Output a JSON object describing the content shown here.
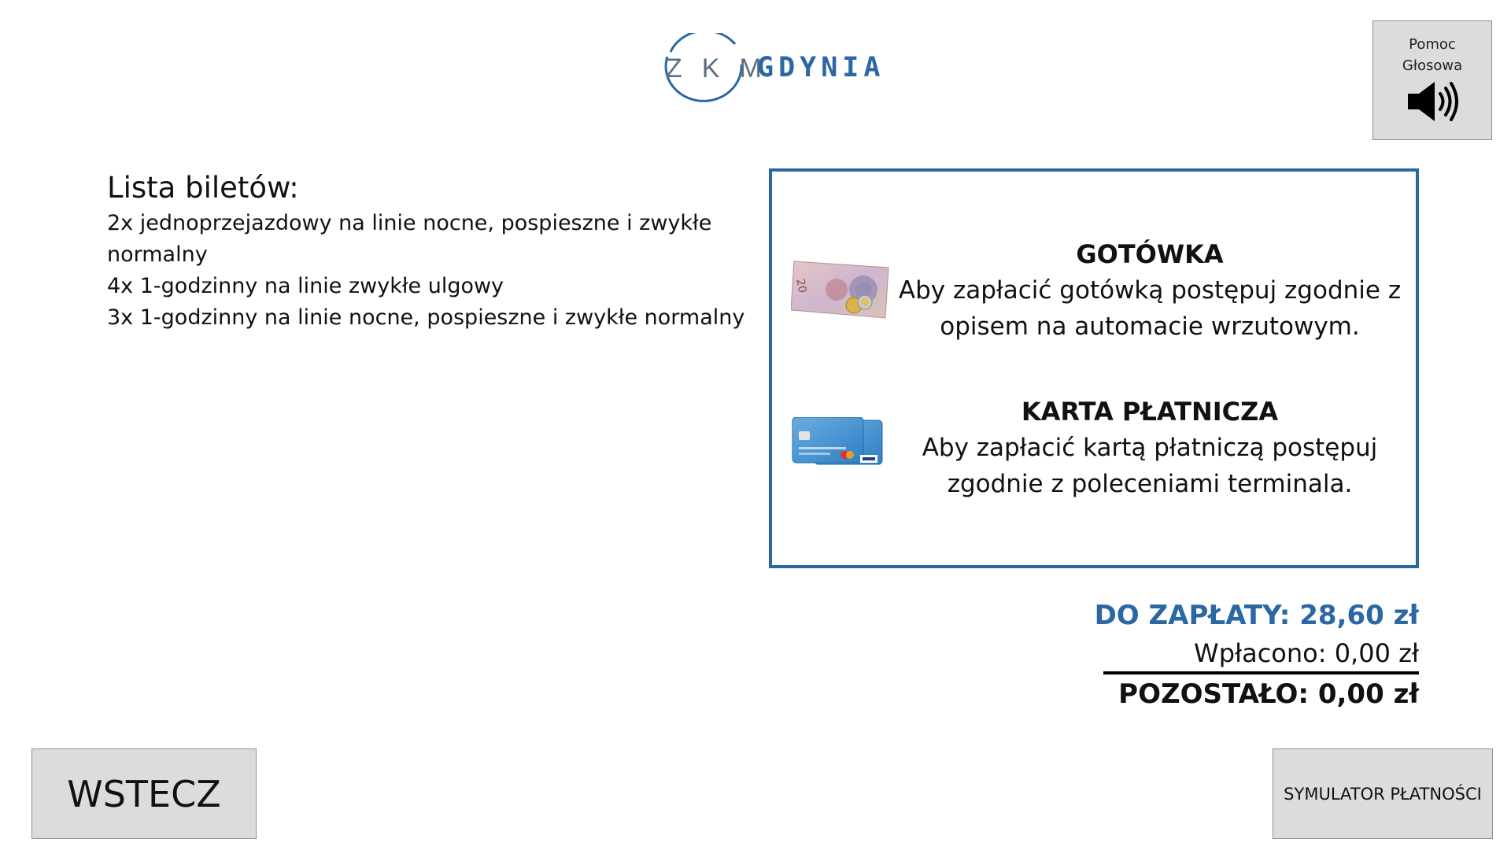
{
  "logo": {
    "letters": "ZKM",
    "city": "GDYNIA"
  },
  "voice_help": {
    "label": "Pomoc Głosowa",
    "icon": "speaker-icon"
  },
  "tickets": {
    "title": "Lista biletów:",
    "items": [
      "2x jednoprzejazdowy na linie nocne, pospieszne i zwykłe normalny",
      "4x 1-godzinny na linie zwykłe ulgowy",
      "3x 1-godzinny na linie nocne, pospieszne i zwykłe normalny"
    ]
  },
  "payment": {
    "cash": {
      "title": "GOTÓWKA",
      "description": "Aby zapłacić gotówką postępuj zgodnie z opisem na automacie wrzutowym.",
      "icon": "cash-banknote-icon"
    },
    "card": {
      "title": "KARTA PŁATNICZA",
      "description": "Aby zapłacić kartą płatniczą postępuj zgodnie z poleceniami terminala.",
      "icon": "payment-card-icon"
    }
  },
  "totals": {
    "due": "DO ZAPŁATY: 28,60 zł",
    "paid": "Wpłacono: 0,00 zł",
    "remaining": "POZOSTAŁO: 0,00 zł"
  },
  "buttons": {
    "back": "WSTECZ",
    "simulator": "SYMULATOR PŁATNOŚCI"
  },
  "colors": {
    "accent": "#2b67a3",
    "button_bg": "#dcdcdc",
    "text": "#111111"
  }
}
